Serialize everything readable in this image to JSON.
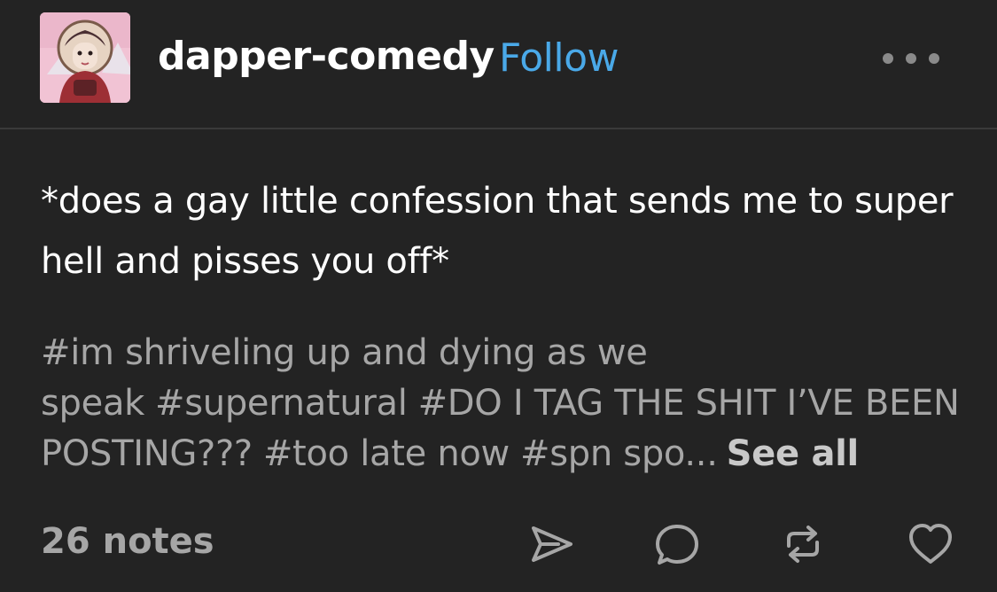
{
  "post": {
    "username": "dapper-comedy",
    "follow_label": "Follow",
    "body": "*does a gay little confession that sends me to super hell and pisses you off*",
    "tags": [
      "#im shriveling up and dying as we speak",
      "#supernatural",
      "#DO I TAG THE SHIT I’VE BEEN POSTING???",
      "#too late now",
      "#spn spo..."
    ],
    "see_all_label": "See all",
    "notes": "26 notes"
  },
  "icons": {
    "more": "more-options-icon",
    "share": "share-send-icon",
    "reply": "reply-bubble-icon",
    "reblog": "reblog-icon",
    "like": "heart-icon"
  },
  "colors": {
    "background": "#232323",
    "link": "#4aa9e8",
    "muted": "#a6a6a6"
  }
}
